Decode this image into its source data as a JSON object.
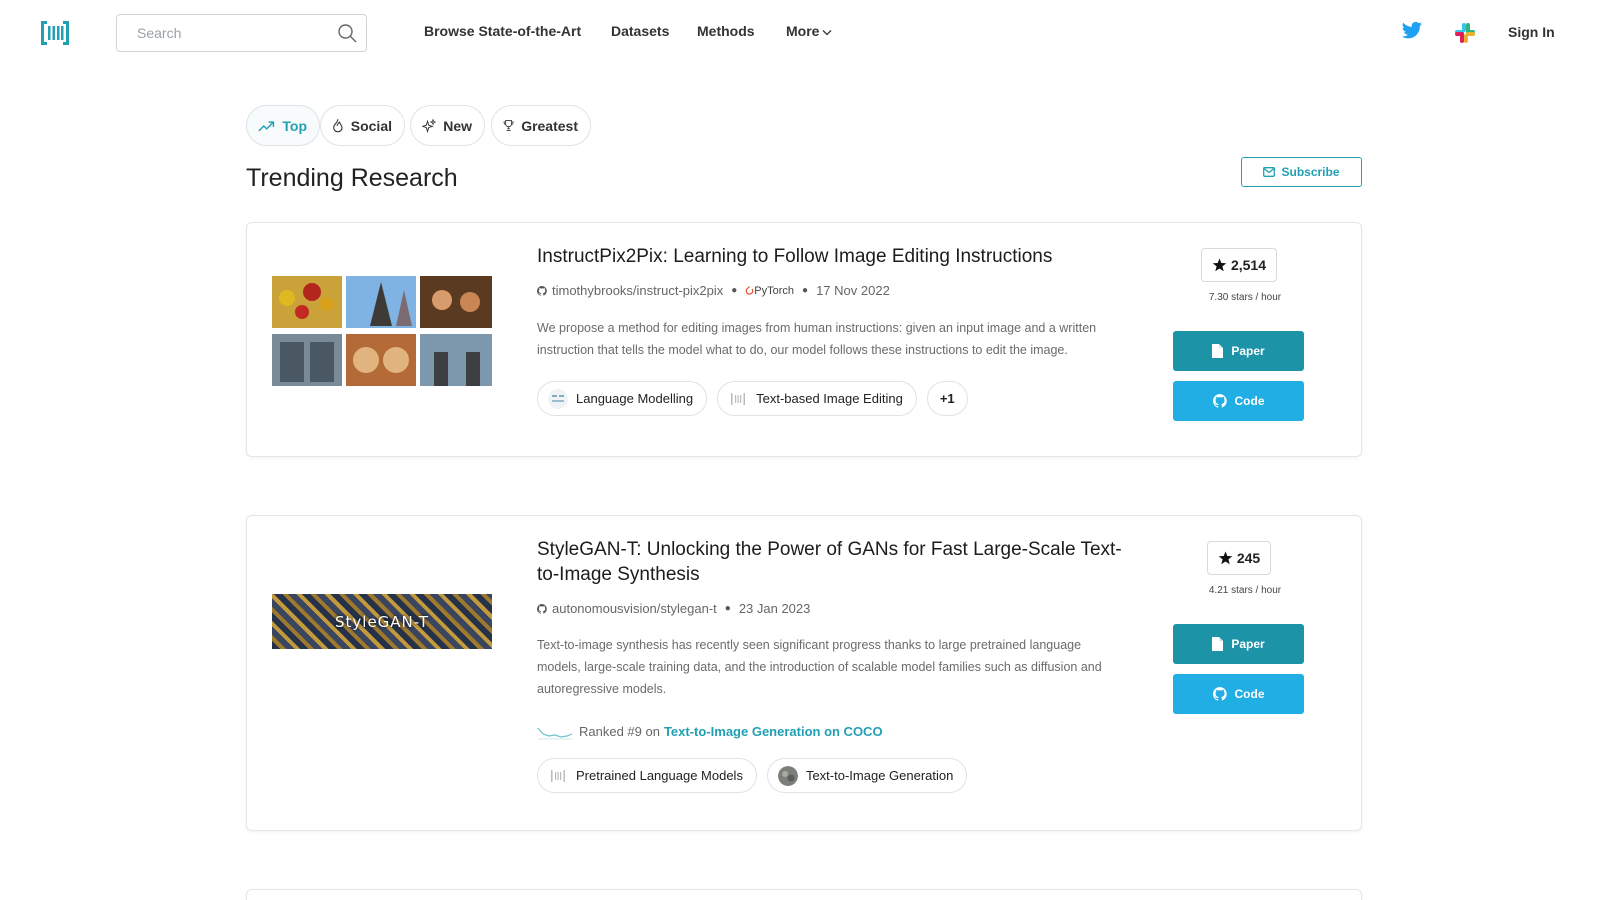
{
  "nav": {
    "search_placeholder": "Search",
    "links": [
      "Browse State-of-the-Art",
      "Datasets",
      "Methods",
      "More"
    ],
    "sign_in": "Sign In",
    "accent": "#21a0b4"
  },
  "filters": {
    "top": "Top",
    "social": "Social",
    "new": "New",
    "greatest": "Greatest"
  },
  "page": {
    "title": "Trending Research",
    "subscribe": "Subscribe"
  },
  "papers": [
    {
      "title": "InstructPix2Pix: Learning to Follow Image Editing Instructions",
      "repo": "timothybrooks/instruct-pix2pix",
      "framework": "PyTorch",
      "date": "17 Nov 2022",
      "abstract": "We propose a method for editing images from human instructions: given an input image and a written instruction that tells the model what to do, our model follows these instructions to edit the image.",
      "tags": [
        "Language Modelling",
        "Text-based Image Editing",
        "+1"
      ],
      "stars": "2,514",
      "rate": "7.30 stars / hour",
      "paper_label": "Paper",
      "code_label": "Code"
    },
    {
      "title": "StyleGAN-T: Unlocking the Power of GANs for Fast Large-Scale Text-to-Image Synthesis",
      "repo": "autonomousvision/stylegan-t",
      "date": "23 Jan 2023",
      "abstract": "Text-to-image synthesis has recently seen significant progress thanks to large pretrained language models, large-scale training data, and the introduction of scalable model families such as diffusion and autoregressive models.",
      "ranked_prefix": "Ranked #9 on",
      "ranked_link": "Text-to-Image Generation on COCO",
      "thumb_text": "StyleGAN-T",
      "tags": [
        "Pretrained Language Models",
        "Text-to-Image Generation"
      ],
      "stars": "245",
      "rate": "4.21 stars / hour",
      "paper_label": "Paper",
      "code_label": "Code"
    }
  ]
}
